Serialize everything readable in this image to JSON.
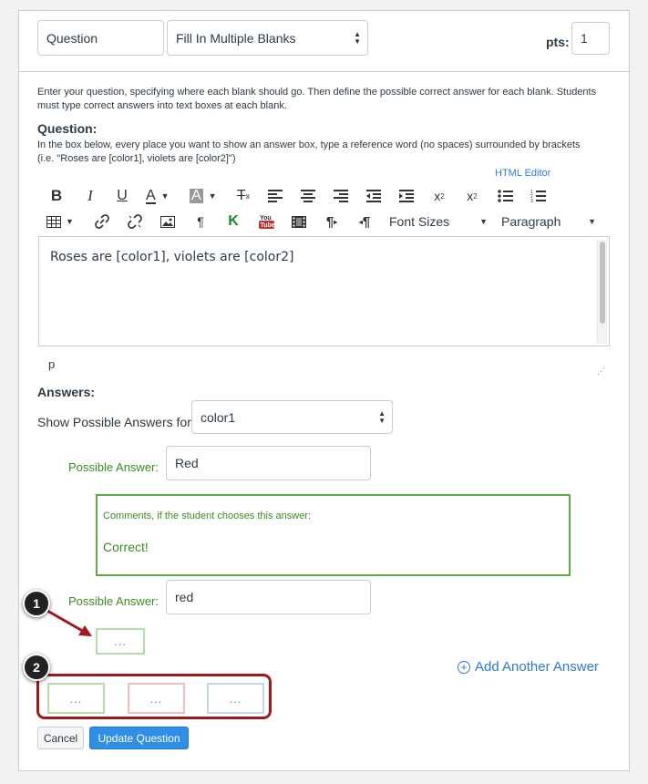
{
  "header": {
    "question_name": "Question",
    "question_type": "Fill In Multiple Blanks",
    "pts_label": "pts:",
    "pts_value": "1"
  },
  "instructions": {
    "intro_line1": "Enter your question, specifying where each blank should go. Then define the possible correct answer for each blank. Students",
    "intro_line2": "must type correct answers into text boxes at each blank.",
    "question_heading": "Question:",
    "hint_line1": "In the box below, every place you want to show an answer box, type a reference word (no spaces) surrounded by brackets",
    "hint_line2": "(i.e. \"Roses are [color1], violets are [color2]\")"
  },
  "editor": {
    "html_editor_link": "HTML Editor",
    "font_sizes_label": "Font Sizes",
    "paragraph_label": "Paragraph",
    "content": "Roses are [color1], violets are [color2]",
    "path": "p"
  },
  "answers": {
    "heading": "Answers:",
    "show_for_label": "Show Possible Answers for",
    "show_for_value": "color1",
    "possible_answer_label": "Possible Answer:",
    "answer1_value": "Red",
    "comment_label": "Comments, if the student chooses this answer:",
    "comment_text": "Correct!",
    "answer2_label": "Possible Answer:",
    "answer2_value": "red",
    "comment_placeholder_1": "...",
    "add_another_label": "Add Another Answer",
    "comment_options": [
      "...",
      "...",
      "..."
    ]
  },
  "buttons": {
    "cancel_label": "Cancel",
    "update_label": "Update Question"
  },
  "callouts": {
    "one": "1",
    "two": "2"
  },
  "colors": {
    "green": "#3b8b1f",
    "link_blue": "#2d7bd6",
    "primary_button": "#2f8ee5",
    "callout_red": "#a0191f"
  }
}
